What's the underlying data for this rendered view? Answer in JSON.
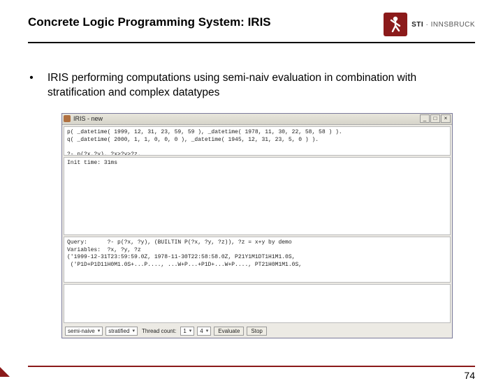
{
  "header": {
    "title": "Concrete Logic Programming System: IRIS",
    "logo": {
      "sti": "STI",
      "sep": " · ",
      "city": "INNSBRUCK"
    }
  },
  "bullet": {
    "mark": "•",
    "text": "IRIS performing computations using semi-naiv evaluation in combination with stratification and complex datatypes"
  },
  "app": {
    "title": "IRIS - new",
    "win_min": "_",
    "win_max": "□",
    "win_close": "×",
    "input_text": "p( _datetime( 1999, 12, 31, 23, 59, 59 ), _datetime( 1978, 11, 30, 22, 58, 58 ) ).\nq( _datetime( 2000, 1, 1, 0, 0, 0 ), _datetime( 1945, 12, 31, 23, 5, 0 ) ).\n\n?- p(?x,?y), ?x>?y>?z.",
    "mid_text": "Init time: 31ms",
    "output_text": "Query:      ?- p(?x, ?y), (BUILTIN P(?x, ?y, ?z)), ?z = x+y by demo\nVariables:  ?x, ?y, ?z\n('1999-12-31T23:59:59.0Z, 1978-11-30T22:58:58.0Z, P21Y1M1DT1H1M1.0S,\n ('P1D+P1D11H0M1.0S+...P...., ...W+P...+P1D+...W+P...., PT21H0M1M1.0S,",
    "toolbar": {
      "combo1": "semi-naive",
      "combo2": "stratified",
      "thread_label": "Thread count:",
      "thread_val": "1",
      "combo3": "4",
      "btn_run": "Evaluate",
      "btn_stop": "Stop"
    }
  },
  "page_number": "74"
}
